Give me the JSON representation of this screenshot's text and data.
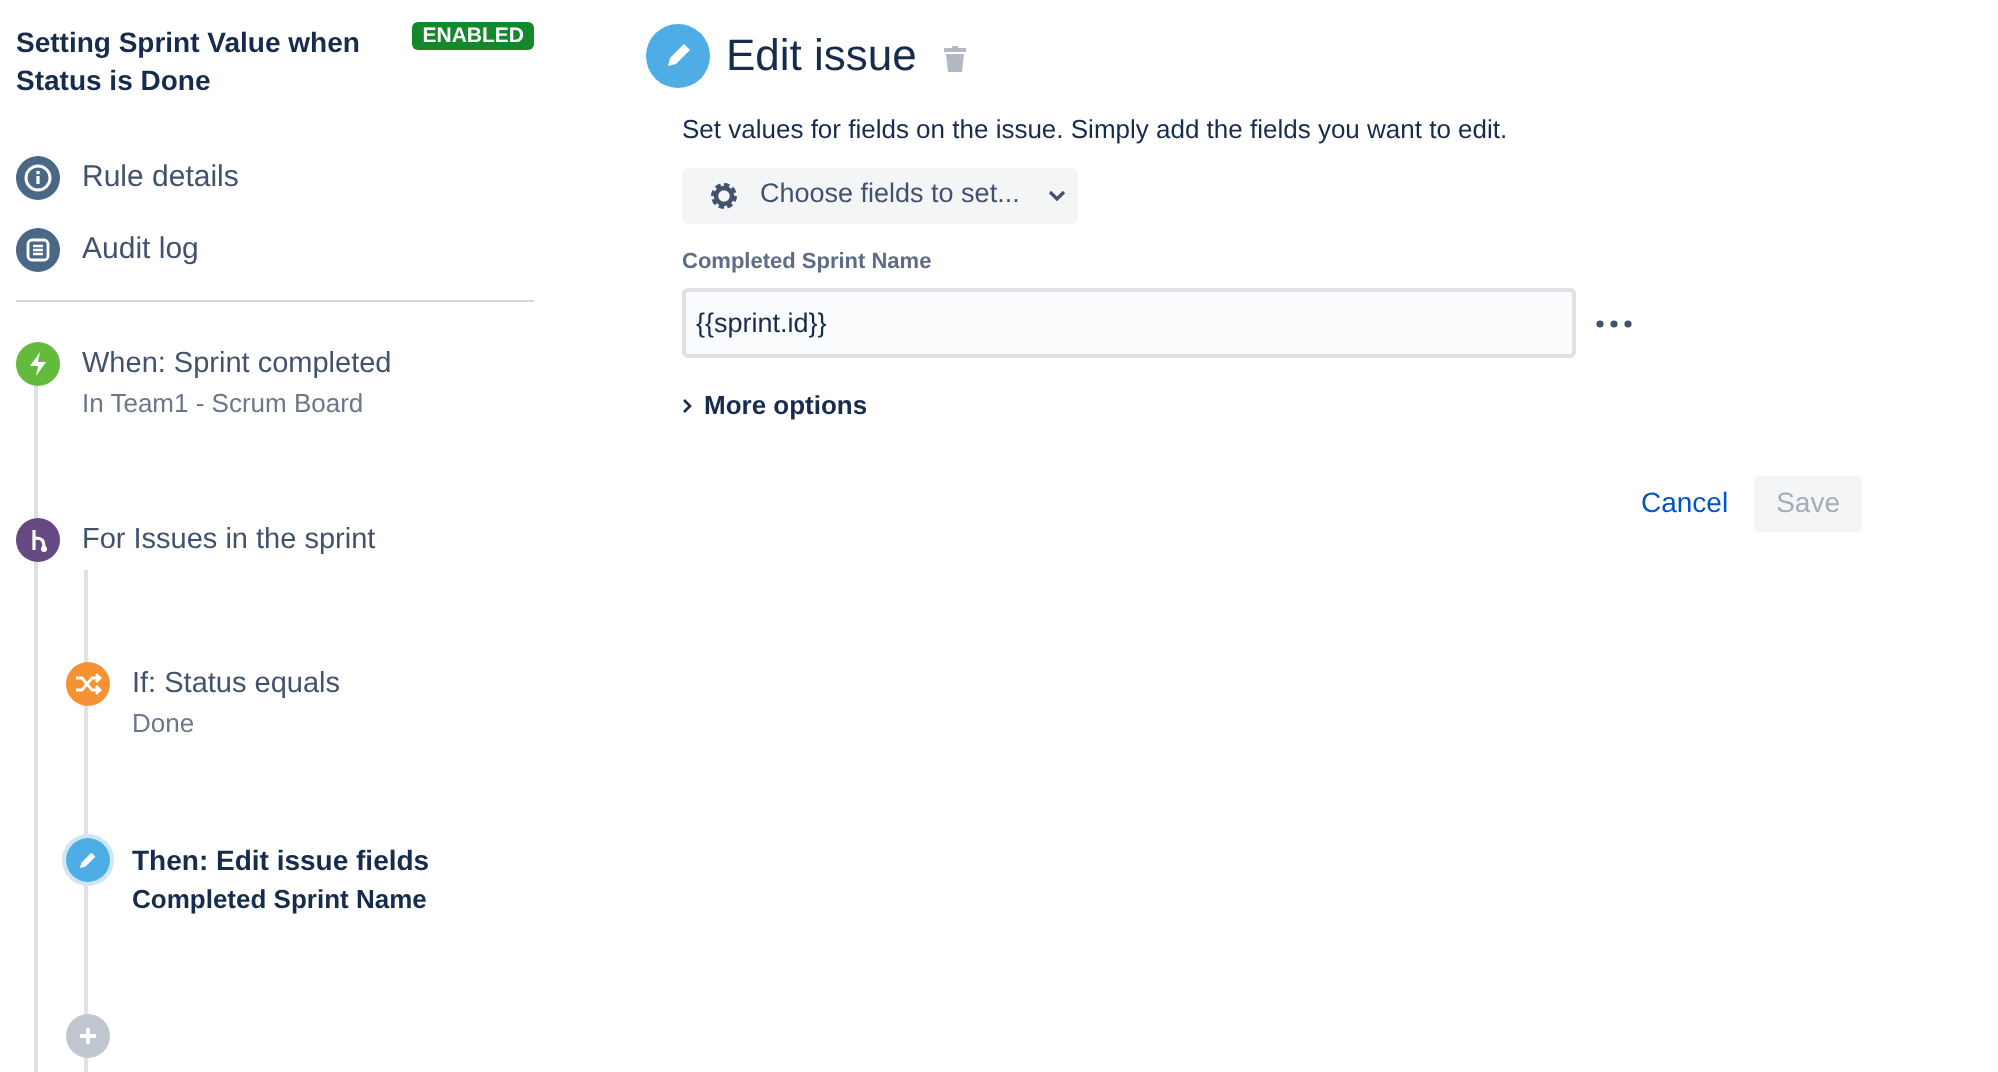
{
  "rule": {
    "title": "Setting Sprint Value when Status is Done",
    "status": "ENABLED"
  },
  "nav": [
    {
      "kind": "info",
      "label": "Rule details"
    },
    {
      "kind": "log",
      "label": "Audit log"
    }
  ],
  "steps": [
    {
      "kind": "trigger",
      "title": "When: Sprint completed",
      "detail": "In Team1 - Scrum Board",
      "selected": false
    },
    {
      "kind": "branch",
      "title": "For Issues in the sprint",
      "selected": false,
      "children": [
        {
          "kind": "condition",
          "title": "If: Status equals",
          "detail": "Done",
          "selected": false
        },
        {
          "kind": "action",
          "title": "Then: Edit issue fields",
          "detail": "Completed Sprint Name",
          "selected": true
        }
      ]
    }
  ],
  "editor": {
    "title": "Edit issue",
    "description": "Set values for fields on the issue. Simply add the fields you want to edit.",
    "chooser": "Choose fields to set...",
    "fields": [
      {
        "label": "Completed Sprint Name",
        "value": "{{sprint.id}}"
      }
    ],
    "more_options": {
      "label": "More options",
      "expanded": false
    },
    "cancel": "Cancel",
    "save": {
      "label": "Save",
      "disabled": true
    }
  }
}
